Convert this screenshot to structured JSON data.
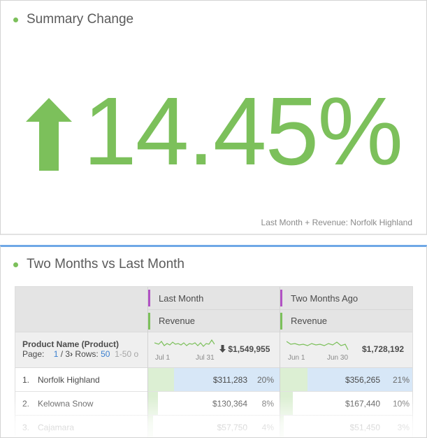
{
  "summary_panel": {
    "title": "Summary Change",
    "value": "14.45%",
    "direction": "up",
    "accent_color": "#7cc05b",
    "footnote": "Last Month + Revenue: Norfolk Highland"
  },
  "table_panel": {
    "title": "Two Months vs Last Month",
    "accent_color": "#6fa8e6",
    "columns": [
      {
        "label": "Last Month",
        "metric": "Revenue",
        "segment_color": "#b152c4",
        "metric_color": "#7cc05b"
      },
      {
        "label": "Two Months Ago",
        "metric": "Revenue",
        "segment_color": "#b152c4",
        "metric_color": "#7cc05b"
      }
    ],
    "dimension_label": "Product Name (Product)",
    "pagination": {
      "page_label": "Page:",
      "page_current": "1",
      "page_total": "/ 3",
      "rows_label": "Rows:",
      "rows_value": "50",
      "range": "1-50 o"
    },
    "totals": [
      {
        "spark_start": "Jul 1",
        "spark_end": "Jul 31",
        "total": "$1,549,955",
        "trend_icon": "arrow-down-icon"
      },
      {
        "spark_start": "Jun 1",
        "spark_end": "Jun 30",
        "total": "$1,728,192"
      }
    ],
    "rows": [
      {
        "num": "1.",
        "name": "Norfolk Highland",
        "c1_value": "$311,283",
        "c1_pct": "20%",
        "c1_share": 0.2,
        "c2_value": "$356,265",
        "c2_pct": "21%",
        "c2_share": 0.21
      },
      {
        "num": "2.",
        "name": "Kelowna Snow",
        "c1_value": "$130,364",
        "c1_pct": "8%",
        "c1_share": 0.08,
        "c2_value": "$167,440",
        "c2_pct": "10%",
        "c2_share": 0.1
      },
      {
        "num": "3.",
        "name": "Cajamara",
        "c1_value": "$57,750",
        "c1_pct": "4%",
        "c1_share": 0.04,
        "c2_value": "$51,450",
        "c2_pct": "3%",
        "c2_share": 0.03
      }
    ]
  }
}
